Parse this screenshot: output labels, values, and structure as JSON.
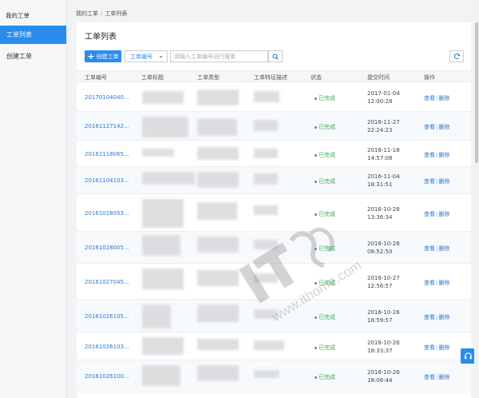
{
  "sidebar": {
    "title": "我的工单",
    "items": [
      {
        "label": "工单列表",
        "active": true
      },
      {
        "label": "创建工单",
        "active": false
      }
    ]
  },
  "breadcrumb": {
    "root": "我的工单",
    "separator": "/",
    "current": "工单列表"
  },
  "panel": {
    "title": "工单列表"
  },
  "toolbar": {
    "create_label": "创建工单",
    "select_value": "工单编号",
    "search_placeholder": "请输入工单编号进行搜索"
  },
  "table": {
    "columns": [
      "工单编号",
      "工单标题",
      "工单类型",
      "工单特征描述",
      "状态",
      "提交时间",
      "操作"
    ],
    "rows": [
      {
        "id": "20170104040...",
        "status": "已完成",
        "date": "2017-01-04",
        "time": "12:00:28"
      },
      {
        "id": "20161127142...",
        "status": "已完成",
        "date": "2016-11-27",
        "time": "22:24:23"
      },
      {
        "id": "20161118065...",
        "status": "已完成",
        "date": "2016-11-18",
        "time": "14:57:08"
      },
      {
        "id": "20161104103...",
        "status": "已完成",
        "date": "2016-11-04",
        "time": "18:31:51"
      },
      {
        "id": "20161028053...",
        "status": "已完成",
        "date": "2016-10-28",
        "time": "13:36:34"
      },
      {
        "id": "20161028005...",
        "status": "已完成",
        "date": "2016-10-28",
        "time": "08:52:50"
      },
      {
        "id": "20161027045...",
        "status": "已完成",
        "date": "2016-10-27",
        "time": "12:56:57"
      },
      {
        "id": "20161026105...",
        "status": "已完成",
        "date": "2016-10-26",
        "time": "18:59:57"
      },
      {
        "id": "20161026103...",
        "status": "已完成",
        "date": "2016-10-26",
        "time": "18:33:37"
      },
      {
        "id": "20161026100...",
        "status": "已完成",
        "date": "2016-10-26",
        "time": "18:06:44"
      }
    ],
    "view_label": "查看",
    "ops_separator": "|",
    "delete_label": "删除"
  },
  "watermark": {
    "text": "www.ithome.com"
  },
  "colors": {
    "accent": "#2b8cee",
    "link": "#2b78d0",
    "success": "#3caa5a"
  },
  "icons": {
    "create": "plus-icon",
    "select": "chevron-down-icon",
    "search": "search-icon",
    "refresh": "refresh-icon",
    "float": "headset-icon"
  }
}
